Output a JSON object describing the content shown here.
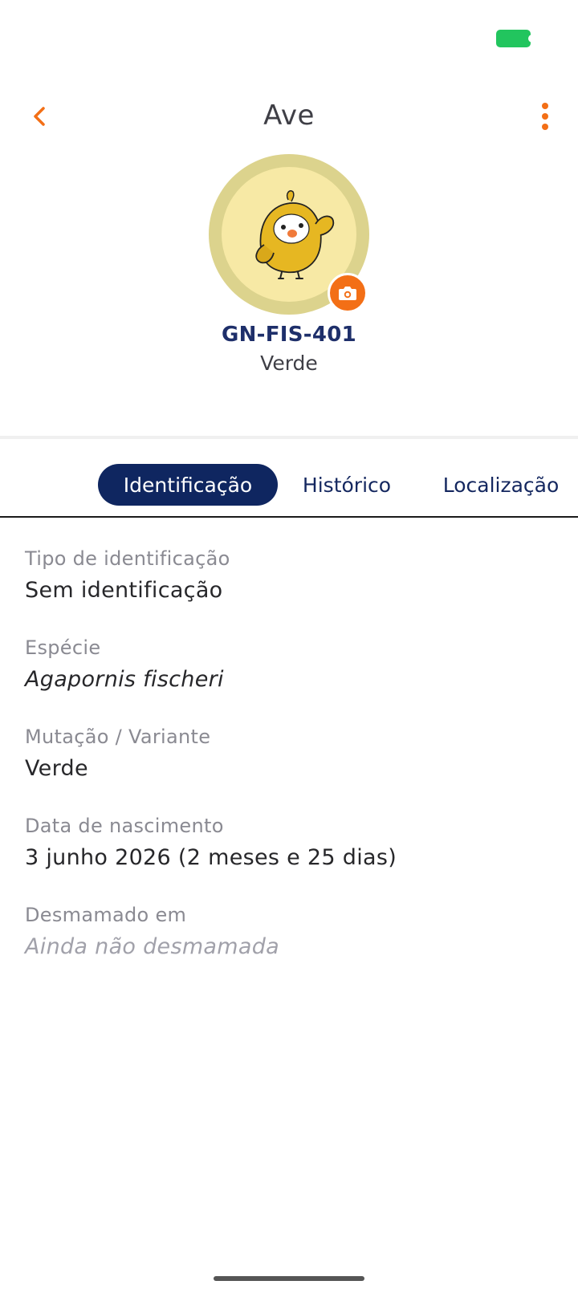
{
  "header": {
    "title": "Ave",
    "back_icon": "chevron-left-icon",
    "more_icon": "more-vertical-icon"
  },
  "profile": {
    "code": "GN-FIS-401",
    "color": "Verde",
    "camera_icon": "camera-icon"
  },
  "tabs": [
    {
      "label": "Identificação",
      "active": true
    },
    {
      "label": "Histórico",
      "active": false
    },
    {
      "label": "Localização",
      "active": false
    }
  ],
  "details": [
    {
      "label": "Tipo de identificação",
      "value": "Sem identificação"
    },
    {
      "label": "Espécie",
      "value": "Agapornis fischeri"
    },
    {
      "label": "Mutação / Variante",
      "value": "Verde"
    },
    {
      "label": "Data de nascimento",
      "value": "3 junho 2026 (2 meses e 25 dias)"
    },
    {
      "label": "Desmamado em",
      "value": "Ainda não desmamada"
    }
  ],
  "colors": {
    "accent": "#f36f16",
    "primary": "#0f2660",
    "battery": "#22c55e"
  }
}
